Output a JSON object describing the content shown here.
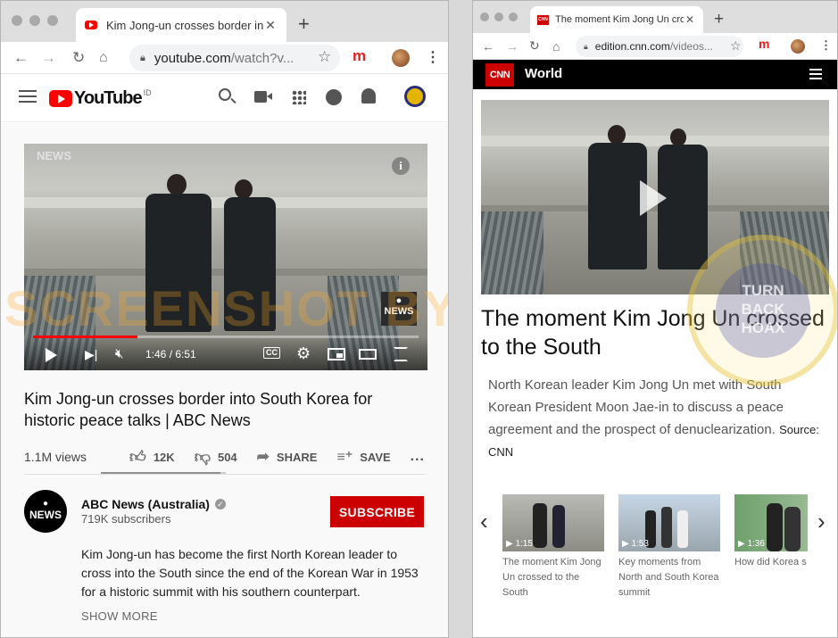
{
  "left_browser": {
    "tab_title": "Kim Jong-un crosses border in",
    "url_host": "youtube.com",
    "url_path": "/watch?v...",
    "extension_letter": "m"
  },
  "youtube": {
    "logo_text": "YouTube",
    "region": "ID",
    "video": {
      "watermark": "NEWS",
      "time": "1:46 / 6:51",
      "progress_fraction": 0.27,
      "badge": "NEWS",
      "cc": "CC"
    },
    "title": "Kim Jong-un crosses border into South Korea for historic peace talks | ABC News",
    "views": "1.1M views",
    "likes": "12K",
    "dislikes": "504",
    "share": "SHARE",
    "save": "SAVE",
    "more": "...",
    "channel": {
      "name": "ABC News (Australia)",
      "subscribers": "719K subscribers",
      "logo_text": "NEWS"
    },
    "subscribe": "SUBSCRIBE",
    "description": "Kim Jong-un has become the first North Korean leader to cross into the South since the end of the Korean War in 1953 for a historic summit with his southern counterpart.",
    "show_more": "SHOW MORE"
  },
  "watermark_text": "SCREENSHOT BY",
  "seal_text": [
    "TURN",
    "BACK",
    "HOAX"
  ],
  "right_browser": {
    "tab_title": "The moment Kim Jong Un cros",
    "url_host": "edition.cnn.com",
    "url_path": "/videos...",
    "extension_letter": "m"
  },
  "cnn": {
    "logo": "CNN",
    "section": "World",
    "headline": "The moment Kim Jong Un crossed to the South",
    "body": "North Korean leader Kim Jong Un met with South Korean President Moon Jae-in to discuss a peace agreement and the prospect of denuclearization.",
    "source": "Source: CNN",
    "related": [
      {
        "duration": "1:15",
        "caption": "The moment Kim Jong Un crossed to the South"
      },
      {
        "duration": "1:53",
        "caption": "Key moments from North and South Korea summit"
      },
      {
        "duration": "1:36",
        "caption": "How did Korea s"
      }
    ]
  },
  "colors": {
    "youtube_red": "#ff0000",
    "subscribe_red": "#cc0000",
    "cnn_red": "#cc0000"
  }
}
